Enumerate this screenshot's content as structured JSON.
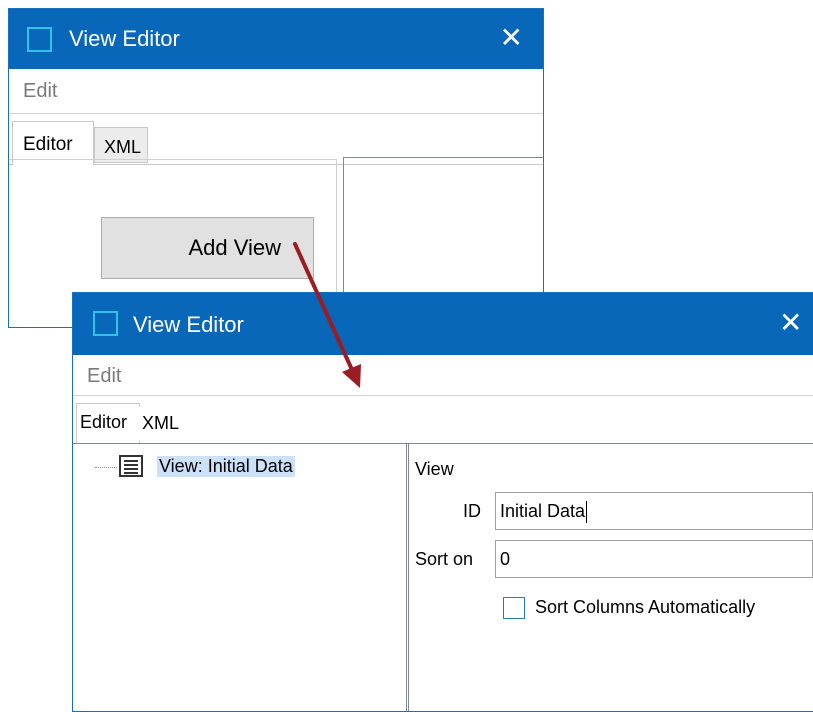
{
  "window_back": {
    "title": "View Editor",
    "close_glyph": "✕",
    "menu": {
      "edit_label": "Edit"
    },
    "tabs": [
      {
        "label": "Editor",
        "active": true
      },
      {
        "label": "XML",
        "active": false
      }
    ],
    "add_view_button_label": "Add View"
  },
  "window_front": {
    "title": "View Editor",
    "close_glyph": "✕",
    "menu": {
      "edit_label": "Edit"
    },
    "tabs": [
      {
        "label": "Editor",
        "active": true
      },
      {
        "label": "XML",
        "active": false
      }
    ],
    "tree": {
      "items": [
        {
          "label": "View: Initial Data",
          "icon": "list-view-icon",
          "selected": true
        }
      ]
    },
    "properties": {
      "group_label": "View",
      "id_label": "ID",
      "id_value": "Initial Data",
      "sort_on_label": "Sort on",
      "sort_on_value": "0",
      "sort_columns_label": "Sort Columns Automatically",
      "sort_columns_checked": false
    }
  },
  "colors": {
    "titlebar": "#0867b9",
    "title_icon": "#35c1e6",
    "arrow": "#9b1c22",
    "selection": "#cce0f7"
  }
}
